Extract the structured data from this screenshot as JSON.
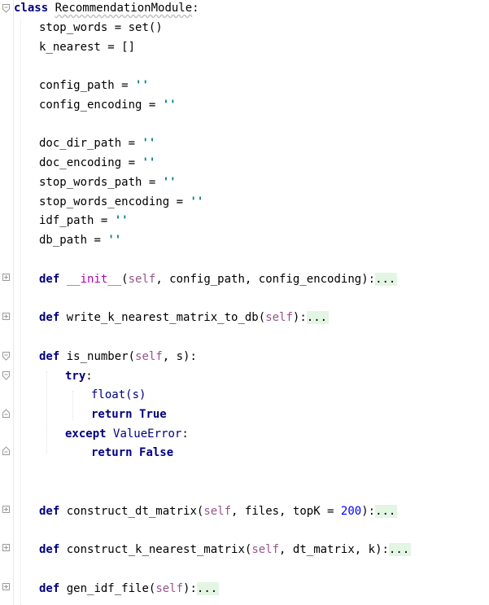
{
  "code": {
    "class_kw": "class",
    "class_name": "RecommendationModule",
    "colon": ":",
    "stop_words": {
      "name": "stop_words",
      "op": " = ",
      "value": "set()"
    },
    "k_nearest": {
      "name": "k_nearest",
      "op": " = ",
      "value": "[]"
    },
    "config_path": {
      "name": "config_path",
      "op": " = ",
      "value": "''"
    },
    "config_encoding": {
      "name": "config_encoding",
      "op": " = ",
      "value": "''"
    },
    "doc_dir_path": {
      "name": "doc_dir_path",
      "op": " = ",
      "value": "''"
    },
    "doc_encoding": {
      "name": "doc_encoding",
      "op": " = ",
      "value": "''"
    },
    "stop_words_path": {
      "name": "stop_words_path",
      "op": " = ",
      "value": "''"
    },
    "stop_words_encoding": {
      "name": "stop_words_encoding",
      "op": " = ",
      "value": "''"
    },
    "idf_path": {
      "name": "idf_path",
      "op": " = ",
      "value": "''"
    },
    "db_path": {
      "name": "db_path",
      "op": " = ",
      "value": "''"
    },
    "def_kw": "def",
    "init": {
      "name": "__init__",
      "open": "(",
      "self": "self",
      "rest": ", config_path, config_encoding",
      "close": "):",
      "fold": "..."
    },
    "write": {
      "name": "write_k_nearest_matrix_to_db",
      "open": "(",
      "self": "self",
      "close": "):",
      "fold": "..."
    },
    "is_number": {
      "name": "is_number",
      "open": "(",
      "self": "self",
      "rest": ", s",
      "close": "):"
    },
    "try_kw": "try",
    "float_call": "float(s)",
    "return_kw": "return",
    "true_kw": "True",
    "false_kw": "False",
    "except_kw": "except",
    "value_error": "ValueError",
    "dt": {
      "name": "construct_dt_matrix",
      "open": "(",
      "self": "self",
      "rest": ", files, topK = ",
      "num": "200",
      "close": "):",
      "fold": "..."
    },
    "kn": {
      "name": "construct_k_nearest_matrix",
      "open": "(",
      "self": "self",
      "rest": ", dt_matrix, k",
      "close": "):",
      "fold": "..."
    },
    "idf": {
      "name": "gen_idf_file",
      "open": "(",
      "self": "self",
      "close": "):",
      "fold": "..."
    }
  }
}
